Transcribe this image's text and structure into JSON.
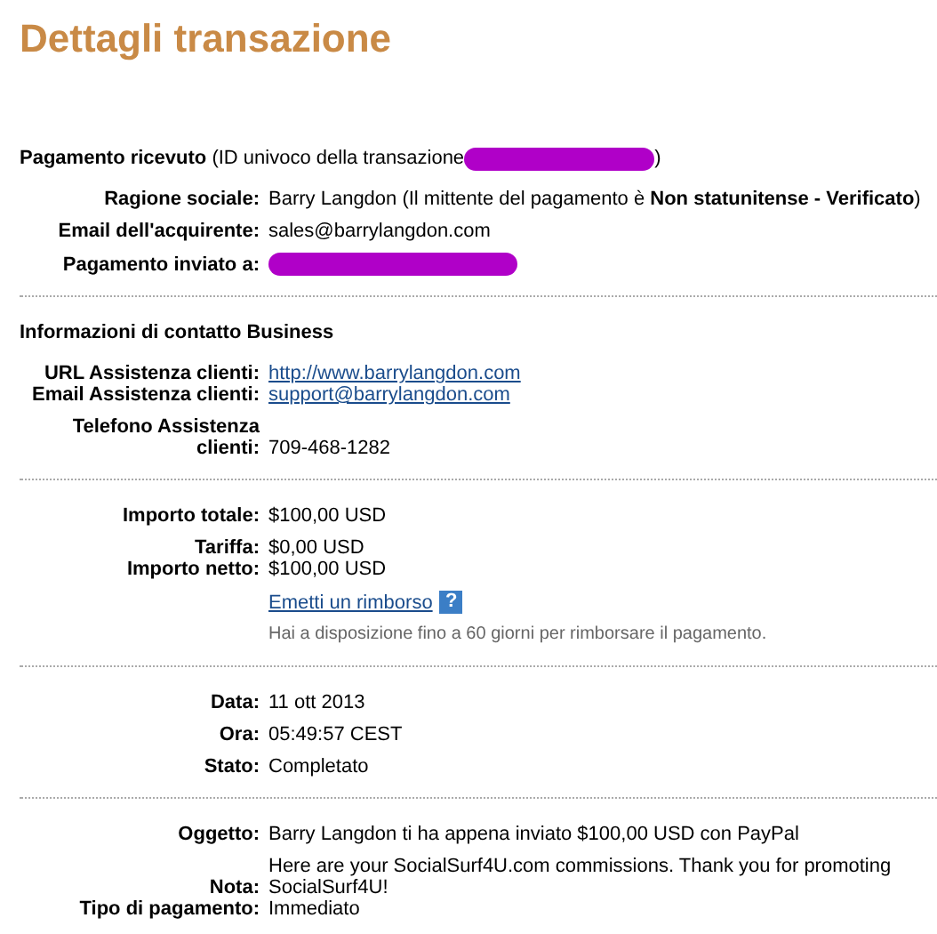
{
  "title": "Dettagli transazione",
  "sections": [
    {
      "heading_parts": [
        {
          "kind": "text",
          "text": "**Pagamento ricevuto** (ID univoco della transazione"
        },
        {
          "kind": "redacted"
        },
        {
          "kind": "text",
          "text": ")"
        }
      ],
      "groups": [
        [
          {
            "label": "Ragione sociale:",
            "kind": "text",
            "value": "Barry Langdon (Il mittente del pagamento è **Non statunitense - Verificato**)"
          }
        ],
        [
          {
            "label": "Email dell'acquirente:",
            "kind": "text",
            "value": "sales@barrylangdon.com"
          }
        ],
        [
          {
            "label": "Pagamento inviato a:",
            "kind": "redacted"
          }
        ]
      ]
    },
    {
      "heading_parts": [
        {
          "kind": "text",
          "text": "**Informazioni di contatto Business**"
        }
      ],
      "groups": [
        [
          {
            "label": "URL Assistenza clienti:",
            "kind": "link",
            "value": "http://www.barrylangdon.com"
          },
          {
            "label": "Email Assistenza clienti:",
            "kind": "link",
            "value": "support@barrylangdon.com"
          }
        ],
        [
          {
            "label": "Telefono Assistenza clienti:",
            "kind": "text",
            "value": "709-468-1282"
          }
        ]
      ]
    },
    {
      "groups": [
        [
          {
            "label": "Importo totale:",
            "kind": "text",
            "value": "$100,00 USD"
          }
        ],
        [
          {
            "label": "Tariffa:",
            "kind": "text",
            "value": "$0,00 USD"
          },
          {
            "label": "Importo netto:",
            "kind": "text",
            "value": "$100,00 USD"
          }
        ],
        [
          {
            "kind": "link",
            "value": "Emetti un rimborso",
            "help": "?"
          }
        ],
        [
          {
            "kind": "note",
            "value": "Hai a disposizione fino a 60 giorni per rimborsare il pagamento."
          }
        ]
      ]
    },
    {
      "groups": [
        [
          {
            "label": "Data:",
            "kind": "text",
            "value": "11 ott 2013"
          }
        ],
        [
          {
            "label": "Ora:",
            "kind": "text",
            "value": "05:49:57 CEST"
          }
        ],
        [
          {
            "label": "Stato:",
            "kind": "text",
            "value": "Completato"
          }
        ]
      ]
    },
    {
      "groups": [
        [
          {
            "label": "Oggetto:",
            "kind": "text",
            "value": "Barry Langdon ti ha appena inviato $100,00 USD con PayPal"
          }
        ],
        [
          {
            "label": "Nota:",
            "kind": "text",
            "value": "Here are your SocialSurf4U.com commissions. Thank you for promoting SocialSurf4U!"
          },
          {
            "label": "Tipo di pagamento:",
            "kind": "text",
            "value": "Immediato"
          }
        ]
      ]
    }
  ]
}
